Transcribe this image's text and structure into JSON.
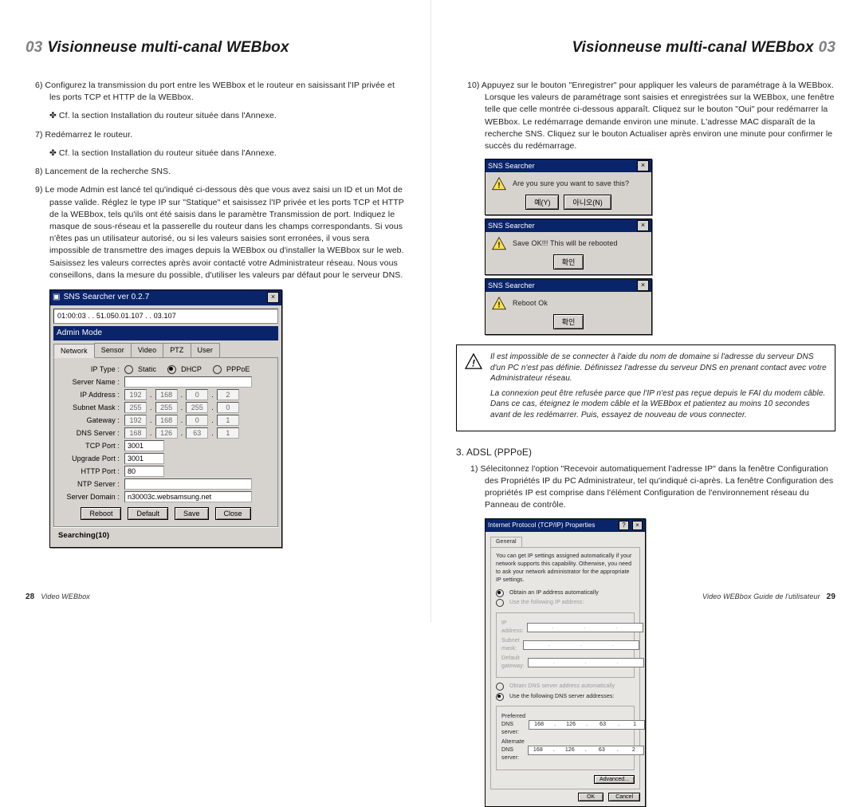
{
  "running": {
    "chapter_num": "03",
    "chapter_title": "Visionneuse multi-canal WEBbox"
  },
  "left": {
    "items": {
      "i6": "6) Configurez la transmission du port entre les WEBbox et le routeur en saisissant l'IP privée et les ports TCP et HTTP de la WEBbox.",
      "i6a": "✤ Cf. la section Installation du routeur située dans l'Annexe.",
      "i7": "7) Redémarrez le routeur.",
      "i7a": "✤ Cf. la section Installation du routeur située dans l'Annexe.",
      "i8": "8) Lancement de la recherche SNS.",
      "i9": "9) Le mode Admin est lancé tel qu'indiqué ci-dessous dès que vous avez saisi un ID et un Mot de passe valide. Réglez le type IP sur \"Statique\" et saisissez l'IP privée et les ports TCP et HTTP de la WEBbox, tels qu'ils ont été saisis dans le paramètre Transmission de port. Indiquez le masque de sous-réseau et la passerelle du routeur dans les champs correspondants. Si vous n'êtes pas un utilisateur autorisé, ou si les valeurs saisies sont erronées, il vous sera impossible de transmettre des images depuis la WEBbox ou d'installer la WEBbox sur le web. Saisissez les valeurs correctes après avoir contacté votre Administrateur réseau. Nous vous conseillons, dans la mesure du possible, d'utiliser les valeurs par défaut pour le serveur DNS."
    },
    "sns": {
      "title": "SNS Searcher ver 0.2.7",
      "strip": "01:00:03 . . 51.050.01.107 . .  03.107",
      "admin_mode": "Admin Mode",
      "tabs": {
        "network": "Network",
        "sensor": "Sensor",
        "video": "Video",
        "ptz": "PTZ",
        "user": "User"
      },
      "labels": {
        "ip_type": "IP Type :",
        "static": "Static",
        "dhcp": "DHCP",
        "pppoe": "PPPoE",
        "server_name": "Server Name :",
        "ip_address": "IP Address :",
        "subnet_mask": "Subnet Mask :",
        "gateway": "Gateway :",
        "dns_server": "DNS Server :",
        "tcp_port": "TCP Port :",
        "upgrade_port": "Upgrade Port :",
        "http_port": "HTTP Port :",
        "ntp_server": "NTP Server :",
        "server_domain": "Server Domain :"
      },
      "values": {
        "ip": [
          "192",
          "168",
          "0",
          "2"
        ],
        "mask": [
          "255",
          "255",
          "255",
          "0"
        ],
        "gw": [
          "192",
          "168",
          "0",
          "1"
        ],
        "dns": [
          "168",
          "126",
          "63",
          "1"
        ],
        "tcp": "3001",
        "upgrade": "3001",
        "http": "80",
        "domain": "n30003c.websamsung.net"
      },
      "buttons": {
        "reboot": "Reboot",
        "default": "Default",
        "save": "Save",
        "close": "Close"
      },
      "status": "Searching(10)"
    },
    "footer": {
      "page": "28",
      "title": "Video WEBbox"
    }
  },
  "right": {
    "items": {
      "i10": "10) Appuyez sur le bouton \"Enregistrer\" pour appliquer les valeurs de paramétrage à la WEBbox. Lorsque les valeurs de paramétrage sont saisies et enregistrées sur la WEBbox, une fenêtre telle que celle montrée ci-dessous apparaît. Cliquez sur le bouton \"Oui\" pour redémarrer la WEBbox. Le redémarrage demande environ une minute. L'adresse MAC disparaît de la recherche SNS. Cliquez sur le bouton Actualiser après environ une minute pour confirmer le succès du redémarrage."
    },
    "dlg": {
      "title": "SNS Searcher",
      "m1": "Are you sure you want to save this?",
      "m2": "Save OK!!! This will be rebooted",
      "m3": "Reboot Ok",
      "yes": "예(Y)",
      "no": "아니오(N)",
      "ok": "확인"
    },
    "notice": {
      "p1": "Il est impossible de se connecter à l'aide du nom de domaine si l'adresse du serveur DNS d'un PC n'est pas définie. Définissez l'adresse du serveur DNS en prenant contact avec votre Administrateur réseau.",
      "p2": "La connexion peut être refusée parce que l'IP n'est pas reçue depuis le FAI du modem câble. Dans ce cas, éteignez le modem câble et la WEBbox et patientez au moins 10 secondes avant de les redémarrer. Puis, essayez de nouveau de vous connecter."
    },
    "adsl_heading": "3. ADSL (PPPoE)",
    "adsl_item": "1)  Sélecitonnez l'option \"Recevoir automatiquement l'adresse IP\" dans la fenêtre Configuration des Propriétés IP du PC Administrateur, tel qu'indiqué ci-après. La fenêtre Configuration des propriétés IP est comprise dans l'élément Configuration de l'environnement réseau du Panneau de contrôle.",
    "tcpip": {
      "title": "Internet Protocol (TCP/IP) Properties",
      "tab": "General",
      "desc": "You can get IP settings assigned automatically if your network supports this capability. Otherwise, you need to ask your network administrator for the appropriate IP settings.",
      "r_auto_ip": "Obtain an IP address automatically",
      "r_use_ip": "Use the following IP address:",
      "ip_label": "IP address:",
      "mask_label": "Subnet mask:",
      "gw_label": "Default gateway:",
      "r_auto_dns": "Obtain DNS server address automatically",
      "r_use_dns": "Use the following DNS server addresses:",
      "pref_dns": "Preferred DNS server:",
      "alt_dns": "Alternate DNS server:",
      "dns1": [
        "168",
        "126",
        "63",
        "1"
      ],
      "dns2": [
        "168",
        "126",
        "63",
        "2"
      ],
      "advanced": "Advanced...",
      "ok": "OK",
      "cancel": "Cancel"
    },
    "footer": {
      "title": "Video WEBbox Guide de l'utilisateur",
      "page": "29"
    }
  }
}
